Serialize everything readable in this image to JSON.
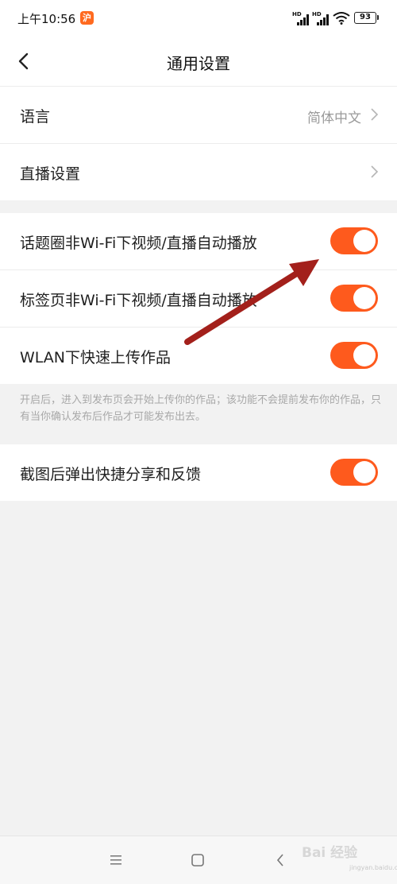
{
  "status_bar": {
    "time": "上午10:56",
    "app_badge": "沪",
    "signal_label": "HD",
    "battery": "93"
  },
  "header": {
    "title": "通用设置"
  },
  "group1": {
    "language": {
      "label": "语言",
      "value": "简体中文"
    },
    "live": {
      "label": "直播设置"
    }
  },
  "group2": {
    "topic_autoplay": {
      "label": "话题圈非Wi-Fi下视频/直播自动播放",
      "on": true
    },
    "tag_autoplay": {
      "label": "标签页非Wi-Fi下视频/直播自动播放",
      "on": true
    },
    "wlan_upload": {
      "label": "WLAN下快速上传作品",
      "on": true
    },
    "note": "开启后，进入到发布页会开始上传你的作品；该功能不会提前发布你的作品，只有当你确认发布后作品才可能发布出去。"
  },
  "group3": {
    "screenshot_share": {
      "label": "截图后弹出快捷分享和反馈",
      "on": true
    }
  },
  "watermark": {
    "brand": "Bai 经验",
    "url": "jingyan.baidu.com"
  },
  "colors": {
    "toggle_on": "#fe5a1d",
    "annotation_arrow": "#a3201b"
  }
}
